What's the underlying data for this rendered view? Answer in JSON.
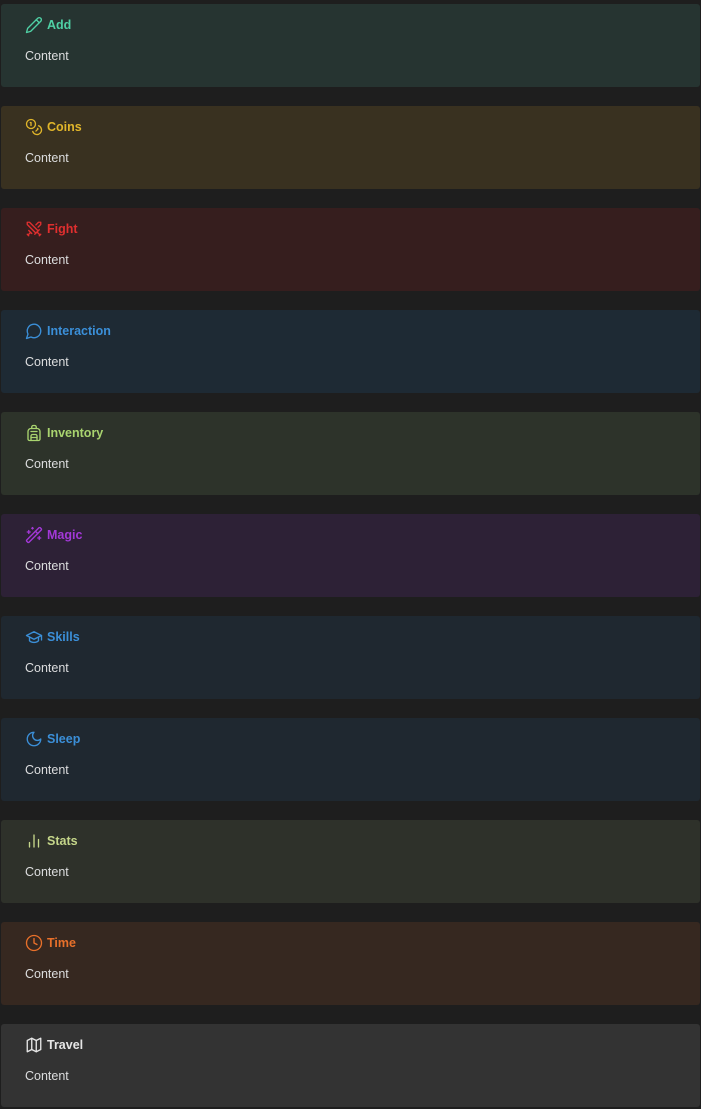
{
  "callouts": [
    {
      "title": "Add",
      "content": "Content",
      "icon": "pencil-icon",
      "accent": "#4fd1a5",
      "background": "#263431"
    },
    {
      "title": "Coins",
      "content": "Content",
      "icon": "coins-icon",
      "accent": "#e0b52a",
      "background": "#393120"
    },
    {
      "title": "Fight",
      "content": "Content",
      "icon": "swords-icon",
      "accent": "#e02f2f",
      "background": "#361e1e"
    },
    {
      "title": "Interaction",
      "content": "Content",
      "icon": "speech-bubble-icon",
      "accent": "#3b8fd8",
      "background": "#1e2a34"
    },
    {
      "title": "Inventory",
      "content": "Content",
      "icon": "backpack-icon",
      "accent": "#a9d46f",
      "background": "#2d332a"
    },
    {
      "title": "Magic",
      "content": "Content",
      "icon": "magic-wand-icon",
      "accent": "#a338d8",
      "background": "#2d2136"
    },
    {
      "title": "Skills",
      "content": "Content",
      "icon": "graduation-cap-icon",
      "accent": "#3b8fd8",
      "background": "#1f2830"
    },
    {
      "title": "Sleep",
      "content": "Content",
      "icon": "moon-icon",
      "accent": "#3b8fd8",
      "background": "#1f2830"
    },
    {
      "title": "Stats",
      "content": "Content",
      "icon": "bar-chart-icon",
      "accent": "#c5d68a",
      "background": "#2e312a"
    },
    {
      "title": "Time",
      "content": "Content",
      "icon": "clock-icon",
      "accent": "#e8702a",
      "background": "#362820"
    },
    {
      "title": "Travel",
      "content": "Content",
      "icon": "map-icon",
      "accent": "#e6e6e6",
      "background": "#333333"
    }
  ]
}
